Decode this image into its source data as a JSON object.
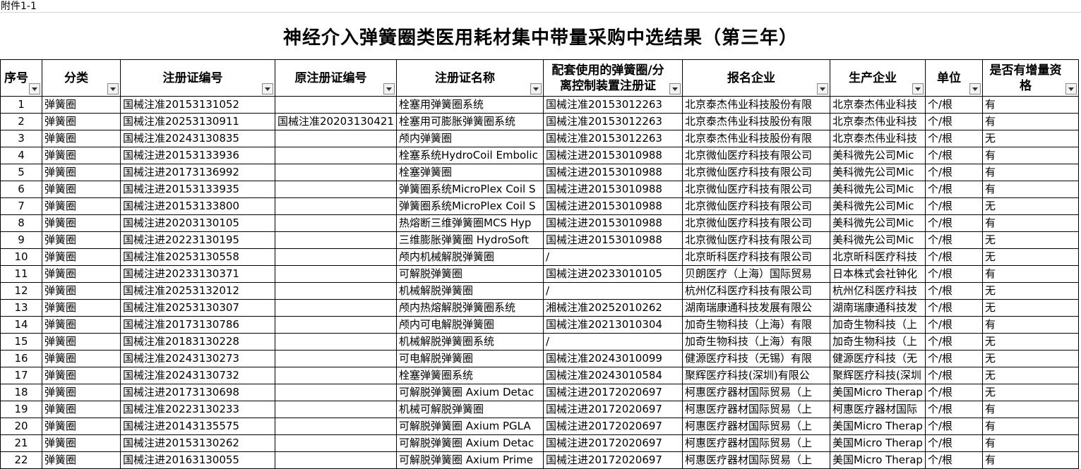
{
  "sheet_label": "附件1-1",
  "title": "神经介入弹簧圈类医用耗材集中带量采购中选结果（第三年）",
  "columns": [
    "序号",
    "分类",
    "注册证编号",
    "原注册证编号",
    "注册证名称",
    "配套使用的弹簧圈/分离控制装置注册证",
    "报名企业",
    "生产企业",
    "单位",
    "是否有增量资格"
  ],
  "rows": [
    [
      "1",
      "弹簧圈",
      "国械注准20153131052",
      "",
      "栓塞用弹簧圈系统",
      "国械注准20153012263",
      "北京泰杰伟业科技股份有限",
      "北京泰杰伟业科技",
      "个/根",
      "有"
    ],
    [
      "2",
      "弹簧圈",
      "国械注准20253130911",
      "国械注准20203130421",
      "栓塞用可膨胀弹簧圈系统",
      "国械注准20153012263",
      "北京泰杰伟业科技股份有限",
      "北京泰杰伟业科技",
      "个/根",
      "有"
    ],
    [
      "3",
      "弹簧圈",
      "国械注准20243130835",
      "",
      "颅内弹簧圈",
      "国械注准20153012263",
      "北京泰杰伟业科技股份有限",
      "北京泰杰伟业科技",
      "个/根",
      "无"
    ],
    [
      "4",
      "弹簧圈",
      "国械注进20153133936",
      "",
      "栓塞系统HydroCoil Embolic",
      "国械注进20153010988",
      "北京微仙医疗科技有限公司",
      "美科微先公司Mic",
      "个/根",
      "有"
    ],
    [
      "5",
      "弹簧圈",
      "国械注进20173136992",
      "",
      "栓塞弹簧圈",
      "国械注进20153010988",
      "北京微仙医疗科技有限公司",
      "美科微先公司Mic",
      "个/根",
      "有"
    ],
    [
      "6",
      "弹簧圈",
      "国械注进20153133935",
      "",
      "弹簧圈系统MicroPlex Coil S",
      "国械注进20153010988",
      "北京微仙医疗科技有限公司",
      "美科微先公司Mic",
      "个/根",
      "有"
    ],
    [
      "7",
      "弹簧圈",
      "国械注进20153133800",
      "",
      "弹簧圈系统MicroPlex Coil S",
      "国械注进20153010988",
      "北京微仙医疗科技有限公司",
      "美科微先公司Mic",
      "个/根",
      "无"
    ],
    [
      "8",
      "弹簧圈",
      "国械注进20203130105",
      "",
      "热熔断三维弹簧圈MCS Hyp",
      "国械注进20153010988",
      "北京微仙医疗科技有限公司",
      "美科微先公司Mic",
      "个/根",
      "有"
    ],
    [
      "9",
      "弹簧圈",
      "国械注进20223130195",
      "",
      "三维膨胀弹簧圈 HydroSoft",
      "国械注进20153010988",
      "北京微仙医疗科技有限公司",
      "美科微先公司Mic",
      "个/根",
      "无"
    ],
    [
      "10",
      "弹簧圈",
      "国械注准20253130558",
      "",
      "颅内机械解脱弹簧圈",
      "/",
      "北京昕科医疗科技有限公司",
      "北京昕科医疗科技",
      "个/根",
      "无"
    ],
    [
      "11",
      "弹簧圈",
      "国械注进20233130371",
      "",
      "可解脱弹簧圈",
      "国械注进20233010105",
      "贝朗医疗（上海）国际贸易",
      "日本株式会社钟化",
      "个/根",
      "有"
    ],
    [
      "12",
      "弹簧圈",
      "国械注准20253132012",
      "",
      "机械解脱弹簧圈",
      "/",
      "杭州亿科医疗科技有限公司",
      "杭州亿科医疗科技",
      "个/根",
      "无"
    ],
    [
      "13",
      "弹簧圈",
      "国械注准20253130307",
      "",
      "颅内热熔解脱弹簧圈系统",
      "湘械注准20252010262",
      "湖南瑞康通科技发展有限公",
      "湖南瑞康通科技发",
      "个/根",
      "无"
    ],
    [
      "14",
      "弹簧圈",
      "国械注准20173130786",
      "",
      "颅内可电解脱弹簧圈",
      "国械注准20213010304",
      "加奇生物科技（上海）有限",
      "加奇生物科技（上",
      "个/根",
      "有"
    ],
    [
      "15",
      "弹簧圈",
      "国械注准20183130228",
      "",
      "机械解脱弹簧圈系统",
      "/",
      "加奇生物科技（上海）有限",
      "加奇生物科技（上",
      "个/根",
      "无"
    ],
    [
      "16",
      "弹簧圈",
      "国械注准20243130273",
      "",
      "可电解脱弹簧圈",
      "国械注准20243010099",
      "健源医疗科技（无锡）有限",
      "健源医疗科技（无",
      "个/根",
      "无"
    ],
    [
      "17",
      "弹簧圈",
      "国械注准20243130732",
      "",
      "栓塞弹簧圈系统",
      "国械注准20243010584",
      "聚辉医疗科技(深圳)有限公",
      "聚辉医疗科技(深圳",
      "个/根",
      "无"
    ],
    [
      "18",
      "弹簧圈",
      "国械注进20173130698",
      "",
      "可解脱弹簧圈 Axium Detac",
      "国械注进20172020697",
      "柯惠医疗器材国际贸易（上",
      "美国Micro Therap",
      "个/根",
      "无"
    ],
    [
      "19",
      "弹簧圈",
      "国械注准20223130233",
      "",
      "机械可解脱弹簧圈",
      "国械注进20172020697",
      "柯惠医疗器材国际贸易（上",
      "柯惠医疗器材国际",
      "个/根",
      "有"
    ],
    [
      "20",
      "弹簧圈",
      "国械注进20143135575",
      "",
      "可解脱弹簧圈 Axium PGLA",
      "国械注进20172020697",
      "柯惠医疗器材国际贸易（上",
      "美国Micro Therap",
      "个/根",
      "有"
    ],
    [
      "21",
      "弹簧圈",
      "国械注进20153130262",
      "",
      "可解脱弹簧圈 Axium Detac",
      "国械注进20172020697",
      "柯惠医疗器材国际贸易（上",
      "美国Micro Therap",
      "个/根",
      "有"
    ],
    [
      "22",
      "弹簧圈",
      "国械注进20163130055",
      "",
      "可解脱弹簧圈 Axium Prime",
      "国械注进20172020697",
      "柯惠医疗器材国际贸易（上",
      "美国Micro Therap",
      "个/根",
      "有"
    ]
  ]
}
